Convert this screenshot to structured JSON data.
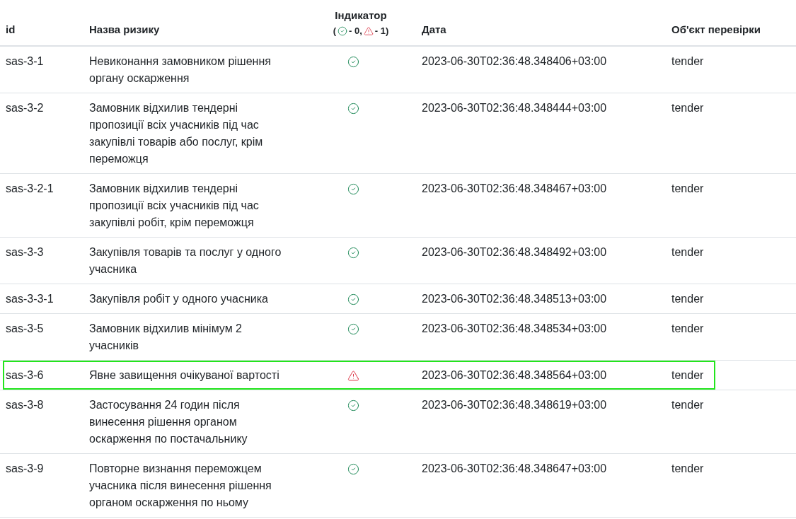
{
  "table": {
    "columns": [
      {
        "title": "id"
      },
      {
        "title": "Назва ризику"
      },
      {
        "title": "Індикатор",
        "legend": {
          "open": "(",
          "items": [
            {
              "kind": "ok",
              "text": "- 0,"
            },
            {
              "kind": "risk",
              "text": "- 1)"
            }
          ]
        }
      },
      {
        "title": "Дата"
      },
      {
        "title": "Об'єкт перевірки"
      }
    ],
    "rows": [
      {
        "id": "sas-3-1",
        "name": "Невиконання замовником рішення органу оскарження",
        "kind": "ok",
        "date": "2023-06-30T02:36:48.348406+03:00",
        "object": "tender",
        "highlighted": false
      },
      {
        "id": "sas-3-2",
        "name": "Замовник відхилив тендерні пропозиції всіх учасників під час закупівлі товарів або послуг, крім переможця",
        "kind": "ok",
        "date": "2023-06-30T02:36:48.348444+03:00",
        "object": "tender",
        "highlighted": false
      },
      {
        "id": "sas-3-2-1",
        "name": "Замовник відхилив тендерні пропозиції всіх учасників під час закупівлі робіт, крім переможця",
        "kind": "ok",
        "date": "2023-06-30T02:36:48.348467+03:00",
        "object": "tender",
        "highlighted": false
      },
      {
        "id": "sas-3-3",
        "name": "Закупівля товарів та послуг у одного учасника",
        "kind": "ok",
        "date": "2023-06-30T02:36:48.348492+03:00",
        "object": "tender",
        "highlighted": false
      },
      {
        "id": "sas-3-3-1",
        "name": "Закупівля робіт у одного учасника",
        "kind": "ok",
        "date": "2023-06-30T02:36:48.348513+03:00",
        "object": "tender",
        "highlighted": false
      },
      {
        "id": "sas-3-5",
        "name": "Замовник відхилив мінімум 2 учасників",
        "kind": "ok",
        "date": "2023-06-30T02:36:48.348534+03:00",
        "object": "tender",
        "highlighted": false
      },
      {
        "id": "sas-3-6",
        "name": "Явне завищення очікуваної вартості",
        "kind": "risk",
        "date": "2023-06-30T02:36:48.348564+03:00",
        "object": "tender",
        "highlighted": true
      },
      {
        "id": "sas-3-8",
        "name": "Застосування 24 годин після винесення рішення органом оскарження по постачальнику",
        "kind": "ok",
        "date": "2023-06-30T02:36:48.348619+03:00",
        "object": "tender",
        "highlighted": false
      },
      {
        "id": "sas-3-9",
        "name": "Повторне визнання переможцем учасника після винесення рішення органом оскарження по ньому",
        "kind": "ok",
        "date": "2023-06-30T02:36:48.348647+03:00",
        "object": "tender",
        "highlighted": false
      }
    ]
  }
}
